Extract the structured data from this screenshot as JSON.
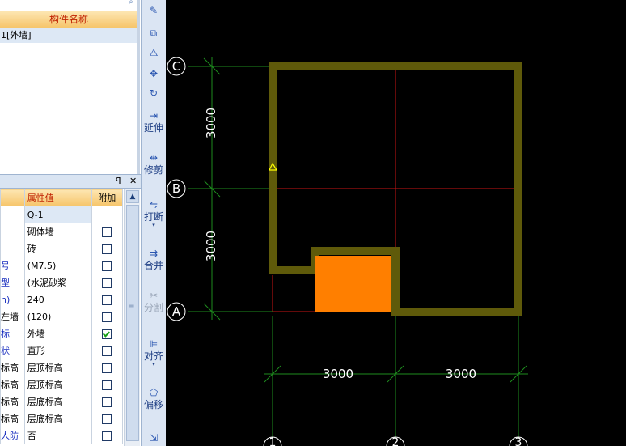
{
  "component_list": {
    "header": "构件名称",
    "rows": [
      "1[外墙]"
    ]
  },
  "properties": {
    "columns": {
      "value": "属性值",
      "extra": "附加"
    },
    "rows": [
      {
        "name": "",
        "value": "Q-1",
        "checkbox": null,
        "name_color": "black"
      },
      {
        "name": "",
        "value": "砌体墙",
        "checkbox": false
      },
      {
        "name": "",
        "value": "砖",
        "checkbox": false
      },
      {
        "name": "号",
        "value": "(M7.5)",
        "checkbox": false
      },
      {
        "name": "型",
        "value": "(水泥砂浆",
        "checkbox": false
      },
      {
        "name": "n)",
        "value": "240",
        "checkbox": false
      },
      {
        "name": "左墙",
        "value": "(120)",
        "checkbox": false,
        "name_color": "black"
      },
      {
        "name": "标",
        "value": "外墙",
        "checkbox": true
      },
      {
        "name": "状",
        "value": "直形",
        "checkbox": false
      },
      {
        "name": "标高",
        "value": "层顶标高",
        "checkbox": false,
        "name_color": "black"
      },
      {
        "name": "标高",
        "value": "层顶标高",
        "checkbox": false,
        "name_color": "black"
      },
      {
        "name": "标高",
        "value": "层底标高",
        "checkbox": false,
        "name_color": "black"
      },
      {
        "name": "标高",
        "value": "层底标高",
        "checkbox": false,
        "name_color": "black"
      },
      {
        "name": "人防",
        "value": "否",
        "checkbox": false
      }
    ]
  },
  "toolbar": {
    "extend": "延伸",
    "trim": "修剪",
    "break": "打断",
    "merge": "合并",
    "split": "分割",
    "align": "对齐",
    "offset": "偏移"
  },
  "drawing": {
    "axes_horizontal": [
      "C",
      "B",
      "A"
    ],
    "axes_vertical": [
      "1",
      "2",
      "3"
    ],
    "dim_vertical": [
      "3000",
      "3000"
    ],
    "dim_horizontal": [
      "3000",
      "3000"
    ],
    "colors": {
      "background": "#000000",
      "wall": "#5f5a0a",
      "selected_fill": "#ff7f00",
      "axis_line": "#c81414",
      "dimension": "#1e8c1e",
      "label": "#ffffff"
    }
  }
}
